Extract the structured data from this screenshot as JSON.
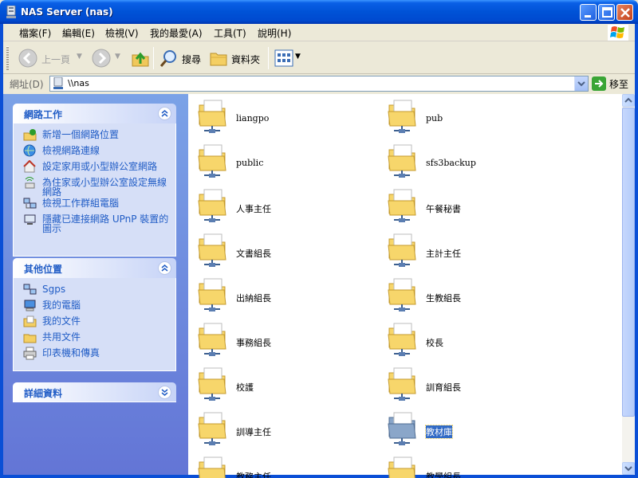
{
  "window": {
    "title": "NAS Server (nas)"
  },
  "menu": [
    {
      "label": "檔案(F)"
    },
    {
      "label": "編輯(E)"
    },
    {
      "label": "檢視(V)"
    },
    {
      "label": "我的最愛(A)"
    },
    {
      "label": "工具(T)"
    },
    {
      "label": "說明(H)"
    }
  ],
  "toolbar": {
    "back_label": "上一頁",
    "search_label": "搜尋",
    "folders_label": "資料夾"
  },
  "address": {
    "label": "網址(D)",
    "value": "\\\\nas",
    "go_label": "移至"
  },
  "tasks_panel": {
    "title": "網路工作",
    "items": [
      {
        "label": "新增一個網路位置",
        "icon": "add-network-place-icon"
      },
      {
        "label": "檢視網路連線",
        "icon": "network-connections-icon"
      },
      {
        "label": "設定家用或小型辦公室網路",
        "icon": "home-network-icon"
      },
      {
        "label": "為住家或小型辦公室設定無線網路",
        "icon": "wireless-network-icon"
      },
      {
        "label": "檢視工作群組電腦",
        "icon": "workgroup-icon"
      },
      {
        "label": "隱藏已連接網路 UPnP 裝置的圖示",
        "icon": "upnp-icon"
      }
    ]
  },
  "places_panel": {
    "title": "其他位置",
    "items": [
      {
        "label": "Sgps",
        "icon": "network-workgroup-icon"
      },
      {
        "label": "我的電腦",
        "icon": "my-computer-icon"
      },
      {
        "label": "我的文件",
        "icon": "my-documents-icon"
      },
      {
        "label": "共用文件",
        "icon": "shared-documents-icon"
      },
      {
        "label": "印表機和傳真",
        "icon": "printer-icon"
      }
    ]
  },
  "details_panel": {
    "title": "詳細資料"
  },
  "folders": [
    {
      "name": "liangpo"
    },
    {
      "name": "pub"
    },
    {
      "name": "public"
    },
    {
      "name": "sfs3backup"
    },
    {
      "name": "人事主任"
    },
    {
      "name": "午餐秘書"
    },
    {
      "name": "文書組長"
    },
    {
      "name": "主計主任"
    },
    {
      "name": "出納組長"
    },
    {
      "name": "生教組長"
    },
    {
      "name": "事務組長"
    },
    {
      "name": "校長"
    },
    {
      "name": "校護"
    },
    {
      "name": "訓育組長"
    },
    {
      "name": "訓導主任"
    },
    {
      "name": "教材庫",
      "selected": true
    },
    {
      "name": "教務主任"
    },
    {
      "name": "教學組長"
    }
  ],
  "colors": {
    "titlebar": "#0052d6",
    "link": "#215dc6",
    "selection": "#316ac5"
  }
}
